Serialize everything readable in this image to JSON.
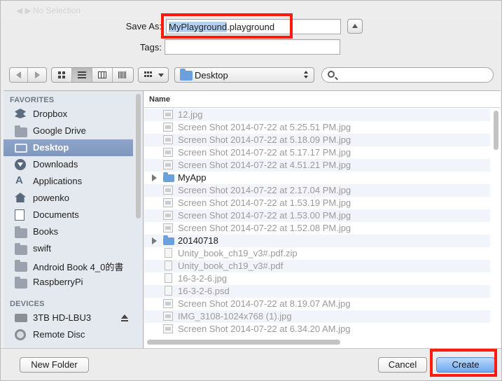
{
  "window": {
    "ghost_title": "No Selection"
  },
  "save": {
    "label": "Save As:",
    "filename_selected": "MyPlayground",
    "filename_extension": ".playground"
  },
  "tags": {
    "label": "Tags:",
    "value": ""
  },
  "toolbar": {
    "location": "Desktop",
    "search_placeholder": ""
  },
  "sidebar": {
    "favorites_title": "FAVORITES",
    "favorites": [
      {
        "label": "Dropbox",
        "icon": "dropbox-icon"
      },
      {
        "label": "Google Drive",
        "icon": "folder-icon"
      },
      {
        "label": "Desktop",
        "icon": "desktop-icon",
        "selected": true
      },
      {
        "label": "Downloads",
        "icon": "downloads-icon"
      },
      {
        "label": "Applications",
        "icon": "applications-icon"
      },
      {
        "label": "powenko",
        "icon": "home-icon"
      },
      {
        "label": "Documents",
        "icon": "documents-icon"
      },
      {
        "label": "Books",
        "icon": "folder-icon"
      },
      {
        "label": "swift",
        "icon": "folder-icon"
      },
      {
        "label": "Android Book 4_0的書",
        "icon": "folder-icon"
      },
      {
        "label": "RaspberryPi",
        "icon": "folder-icon"
      }
    ],
    "devices_title": "DEVICES",
    "devices": [
      {
        "label": "3TB HD-LBU3",
        "icon": "drive-icon"
      },
      {
        "label": "Remote Disc",
        "icon": "disc-icon"
      }
    ]
  },
  "files": {
    "column_name": "Name",
    "rows": [
      {
        "name": "12.jpg",
        "kind": "image"
      },
      {
        "name": "Screen Shot 2014-07-22 at 5.25.51 PM.jpg",
        "kind": "image"
      },
      {
        "name": "Screen Shot 2014-07-22 at 5.18.09 PM.jpg",
        "kind": "image"
      },
      {
        "name": "Screen Shot 2014-07-22 at 5.17.17 PM.jpg",
        "kind": "image"
      },
      {
        "name": "Screen Shot 2014-07-22 at 4.51.21 PM.jpg",
        "kind": "image"
      },
      {
        "name": "MyApp",
        "kind": "folder"
      },
      {
        "name": "Screen Shot 2014-07-22 at 2.17.04 PM.jpg",
        "kind": "image"
      },
      {
        "name": "Screen Shot 2014-07-22 at 1.53.19 PM.jpg",
        "kind": "image"
      },
      {
        "name": "Screen Shot 2014-07-22 at 1.53.00 PM.jpg",
        "kind": "image"
      },
      {
        "name": "Screen Shot 2014-07-22 at 1.52.08 PM.jpg",
        "kind": "image"
      },
      {
        "name": "20140718",
        "kind": "folder"
      },
      {
        "name": "Unity_book_ch19_v3#.pdf.zip",
        "kind": "doc"
      },
      {
        "name": "Unity_book_ch19_v3#.pdf",
        "kind": "doc"
      },
      {
        "name": "16-3-2-6.jpg",
        "kind": "doc"
      },
      {
        "name": "16-3-2-6.psd",
        "kind": "doc"
      },
      {
        "name": "Screen Shot 2014-07-22 at 8.19.07 AM.jpg",
        "kind": "image"
      },
      {
        "name": "IMG_3108-1024x768 (1).jpg",
        "kind": "image"
      },
      {
        "name": "Screen Shot 2014-07-22 at 6.34.20 AM.jpg",
        "kind": "image"
      }
    ]
  },
  "buttons": {
    "new_folder": "New Folder",
    "cancel": "Cancel",
    "create": "Create"
  },
  "colors": {
    "selection": "#b3d1f7",
    "sidebar_selected": "#8ea4c9",
    "annotation_red": "#ff1a0e",
    "default_button": "#6ea9ef"
  }
}
